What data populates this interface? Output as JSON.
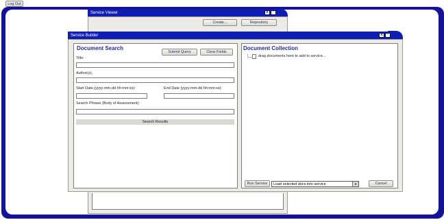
{
  "logout_label": "Log Out",
  "service_viewer": {
    "title": "Service Viewer",
    "create_label": "Create...",
    "repository_label": "Repository",
    "close_glyph": "X",
    "restore_glyph": "▫"
  },
  "service_builder": {
    "title": "Service Builder",
    "close_glyph": "X",
    "restore_glyph": "▫",
    "search": {
      "heading": "Document Search",
      "submit_label": "Submit Query",
      "clear_label": "Clear Fields",
      "title_label": "Title:",
      "authors_label": "Author(s):",
      "start_date_label": "Start Date (yyyy-mm-dd hh:mm:ss):",
      "end_date_label": "End Date (yyyy-mm-dd hh:mm:ss):",
      "phrase_label": "Search Phrase (Body of Assessment):",
      "results_label": "Search Results"
    },
    "collection": {
      "heading": "Document Collection",
      "tree_item": "drag documents here to add to service...",
      "run_label": "Run Service",
      "select_value": "Load selected docs into service",
      "cancel_label": "Cancel"
    }
  }
}
